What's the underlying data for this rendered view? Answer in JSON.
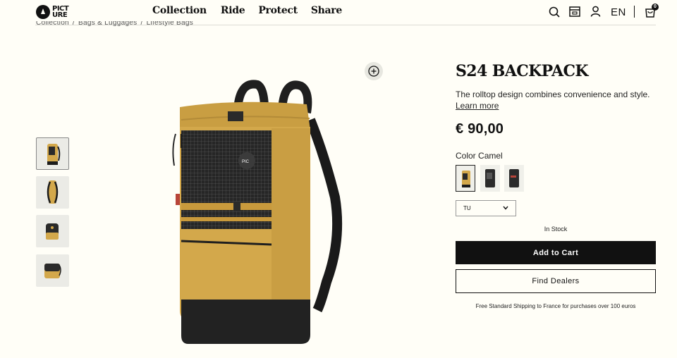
{
  "brand": {
    "logo_text": "PICT URE"
  },
  "nav": {
    "items": [
      "Collection",
      "Ride",
      "Protect",
      "Share"
    ]
  },
  "header": {
    "language": "EN",
    "cart_count": "0"
  },
  "breadcrumb": [
    "Collection",
    "Bags & Luggages",
    "Lifestyle Bags"
  ],
  "product": {
    "title": "S24 BACKPACK",
    "description": "The rolltop design combines convenience and style.",
    "learn_more": "Learn more",
    "price": "€ 90,00",
    "color_prefix": "Color",
    "color_name": "Camel",
    "size_value": "TU",
    "stock_status": "In Stock",
    "add_to_cart": "Add to Cart",
    "find_dealers": "Find Dealers",
    "shipping_note": "Free Standard Shipping to France for purchases over 100 euros"
  },
  "colors": {
    "camel": "#d3a84b",
    "black": "#1c1c1c",
    "background": "#fffef7"
  }
}
